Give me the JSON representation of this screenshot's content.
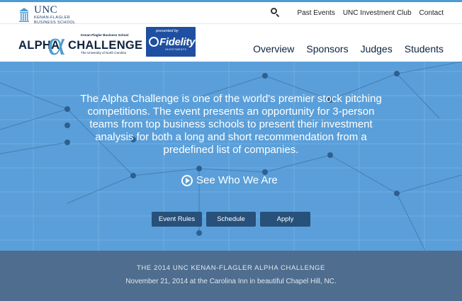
{
  "unc_logo": {
    "main": "UNC",
    "sub_line1": "KENAN-FLAGLER",
    "sub_line2": "BUSINESS SCHOOL",
    "icon": "old-well-icon"
  },
  "top_nav": {
    "search_icon": "search-icon",
    "items": [
      "Past Events",
      "UNC Investment Club",
      "Contact"
    ]
  },
  "brand": {
    "alpha": "ALPHA",
    "alpha_glyph": "α",
    "challenge": "CHALLENGE",
    "school_line": "Kenan-Flagler Business School",
    "university_line": "The University of North Carolina"
  },
  "sponsor": {
    "presented_by": "presented by",
    "name": "Fidelity",
    "sub": "INVESTMENTS"
  },
  "main_nav": {
    "items": [
      "Overview",
      "Sponsors",
      "Judges",
      "Students"
    ]
  },
  "hero": {
    "description": "The Alpha Challenge is one of the world's premier stock pitching competitions. The event presents an opportunity for 3-person teams from top business schools to present their investment analysis for both a long and short recommendation from a predefined list of companies.",
    "video_link": "See Who We Are",
    "buttons": {
      "rules": "Event Rules",
      "schedule": "Schedule",
      "apply": "Apply"
    }
  },
  "band": {
    "title": "THE 2014 UNC KENAN-FLAGLER ALPHA CHALLENGE",
    "date": "November 21, 2014 at the Carolina Inn in beautiful Chapel Hill, NC."
  },
  "colors": {
    "accent": "#4b9cd3",
    "navy": "#0c2340",
    "hero_bg": "#5a9fd9",
    "button": "#27507a",
    "band": "#4f6d8e",
    "sponsor_blue": "#1e4fa1"
  }
}
